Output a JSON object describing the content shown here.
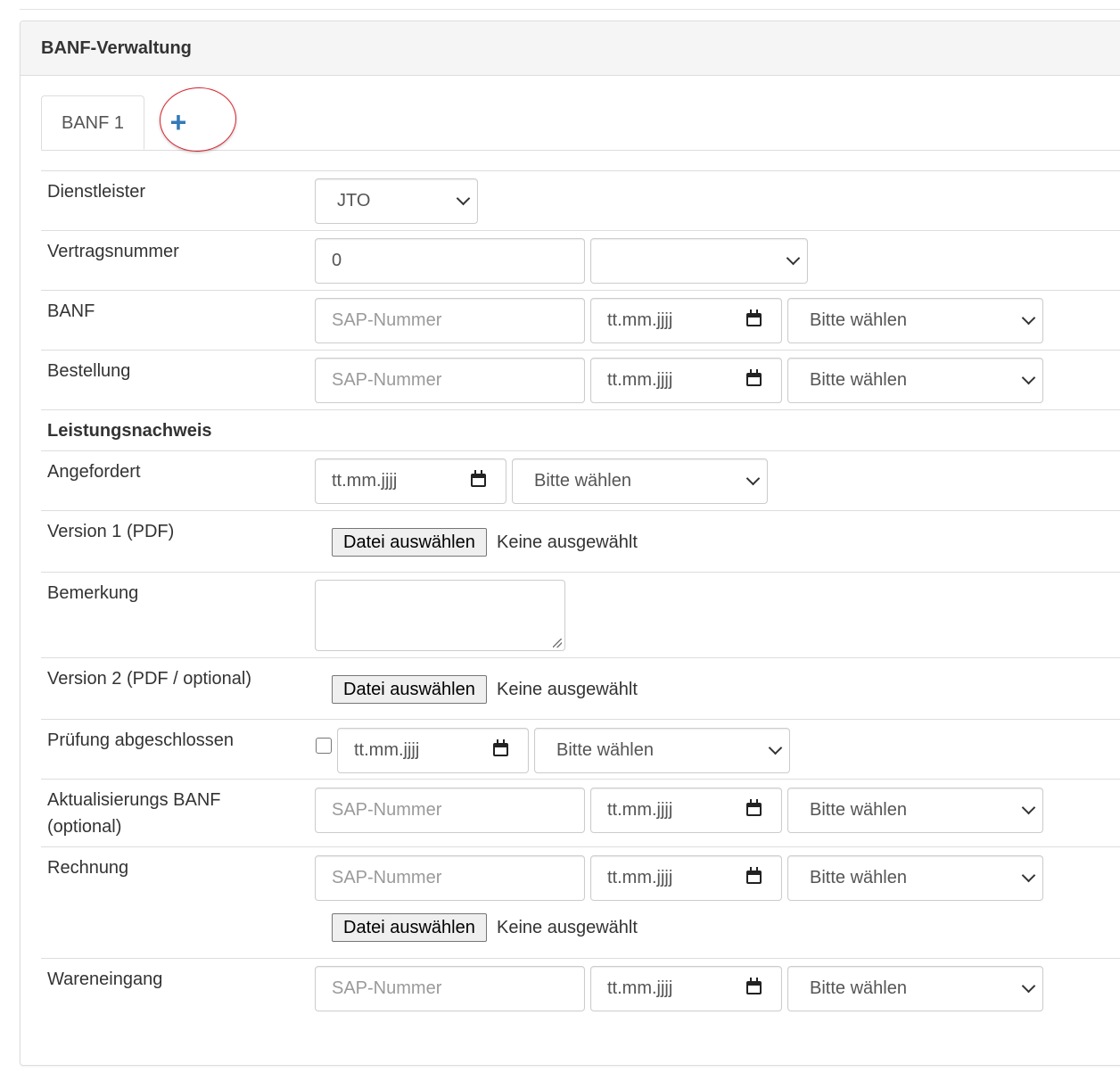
{
  "panel": {
    "title": "BANF-Verwaltung"
  },
  "tabs": {
    "active_label": "BANF 1",
    "add_symbol": "+"
  },
  "placeholders": {
    "sap": "SAP-Nummer",
    "date": "tt.mm.jjjj",
    "select": "Bitte wählen"
  },
  "file": {
    "button": "Datei auswählen",
    "status": "Keine ausgewählt"
  },
  "form": {
    "dienstleister": {
      "label": "Dienstleister",
      "value": "JTO"
    },
    "vertragsnummer": {
      "label": "Vertragsnummer",
      "value": "0",
      "select_value": ""
    },
    "banf": {
      "label": "BANF"
    },
    "bestellung": {
      "label": "Bestellung"
    },
    "leistungsnachweis": {
      "label": "Leistungsnachweis"
    },
    "angefordert": {
      "label": "Angefordert"
    },
    "version1": {
      "label": "Version 1 (PDF)"
    },
    "bemerkung": {
      "label": "Bemerkung",
      "value": ""
    },
    "version2": {
      "label": "Version 2 (PDF / optional)"
    },
    "pruefung": {
      "label": "Prüfung abgeschlossen",
      "checked": false
    },
    "aktualisierung": {
      "label_line1": "Aktualisierungs BANF",
      "label_line2": "(optional)"
    },
    "rechnung": {
      "label": "Rechnung"
    },
    "wareneingang": {
      "label": "Wareneingang"
    }
  },
  "colors": {
    "accent": "#337ab7",
    "annotation_circle": "#d9232d",
    "border": "#dddddd",
    "heading_bg": "#f5f5f5"
  }
}
